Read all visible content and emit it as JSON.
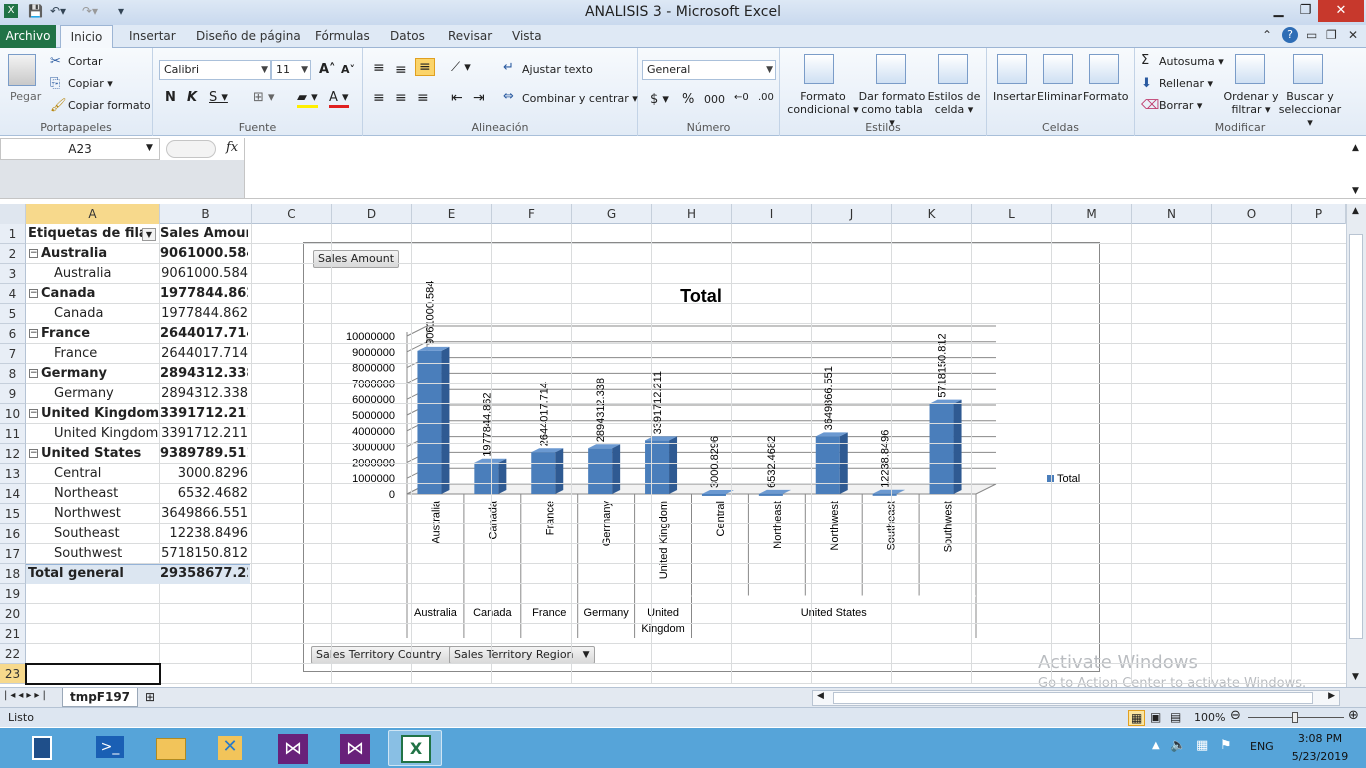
{
  "window": {
    "title": "ANALISIS 3  -  Microsoft Excel",
    "minimize": "▁",
    "restore": "❐",
    "close": "✕"
  },
  "tabs": [
    "Archivo",
    "Inicio",
    "Insertar",
    "Diseño de página",
    "Fórmulas",
    "Datos",
    "Revisar",
    "Vista"
  ],
  "ribbon": {
    "portapapeles": {
      "label": "Portapapeles",
      "pegar": "Pegar",
      "cortar": "Cortar",
      "copiar": "Copiar ▾",
      "copiar_formato": "Copiar formato"
    },
    "fuente": {
      "label": "Fuente",
      "font": "Calibri",
      "size": "11"
    },
    "alineacion": {
      "label": "Alineación",
      "ajustar": "Ajustar texto",
      "combinar": "Combinar y centrar ▾"
    },
    "numero": {
      "label": "Número",
      "format": "General"
    },
    "estilos": {
      "label": "Estilos",
      "formato_condicional": "Formato condicional ▾",
      "formato_tabla": "Dar formato como tabla ▾",
      "estilos_celda": "Estilos de celda ▾"
    },
    "celdas": {
      "label": "Celdas",
      "insertar": "Insertar",
      "eliminar": "Eliminar",
      "formato": "Formato"
    },
    "modificar": {
      "label": "Modificar",
      "autosuma": "Autosuma ▾",
      "rellenar": "Rellenar ▾",
      "borrar": "Borrar ▾",
      "ordenar": "Ordenar y filtrar ▾",
      "buscar": "Buscar y seleccionar ▾"
    }
  },
  "namebox": "A23",
  "fx": "fx",
  "columns": [
    "A",
    "B",
    "C",
    "D",
    "E",
    "F",
    "G",
    "H",
    "I",
    "J",
    "K",
    "L",
    "M",
    "N",
    "O",
    "P"
  ],
  "rows": [
    "1",
    "2",
    "3",
    "4",
    "5",
    "6",
    "7",
    "8",
    "9",
    "10",
    "11",
    "12",
    "13",
    "14",
    "15",
    "16",
    "17",
    "18",
    "19",
    "20",
    "21",
    "22",
    "23"
  ],
  "pivot": {
    "header_a": "Etiquetas de fila",
    "header_b": "Sales Amount",
    "rows": [
      {
        "label": "Australia",
        "value": "9061000.584",
        "level": 0
      },
      {
        "label": "Australia",
        "value": "9061000.584",
        "level": 1
      },
      {
        "label": "Canada",
        "value": "1977844.862",
        "level": 0
      },
      {
        "label": "Canada",
        "value": "1977844.862",
        "level": 1
      },
      {
        "label": "France",
        "value": "2644017.714",
        "level": 0
      },
      {
        "label": "France",
        "value": "2644017.714",
        "level": 1
      },
      {
        "label": "Germany",
        "value": "2894312.338",
        "level": 0
      },
      {
        "label": "Germany",
        "value": "2894312.338",
        "level": 1
      },
      {
        "label": "United Kingdom",
        "value": "3391712.211",
        "level": 0
      },
      {
        "label": "United Kingdom",
        "value": "3391712.211",
        "level": 1
      },
      {
        "label": "United States",
        "value": "9389789.511",
        "level": 0
      },
      {
        "label": "Central",
        "value": "3000.8296",
        "level": 1
      },
      {
        "label": "Northeast",
        "value": "6532.4682",
        "level": 1
      },
      {
        "label": "Northwest",
        "value": "3649866.551",
        "level": 1
      },
      {
        "label": "Southeast",
        "value": "12238.8496",
        "level": 1
      },
      {
        "label": "Southwest",
        "value": "5718150.812",
        "level": 1
      }
    ],
    "total_label": "Total general",
    "total_value": "29358677.22"
  },
  "chart_data": {
    "type": "bar",
    "title": "Total",
    "categories": [
      "Australia",
      "Canada",
      "France",
      "Germany",
      "United Kingdom",
      "Central",
      "Northeast",
      "Northwest",
      "Southeast",
      "Southwest"
    ],
    "groups": [
      "Australia",
      "Canada",
      "France",
      "Germany",
      "United Kingdom",
      "United States"
    ],
    "group_spans": [
      1,
      1,
      1,
      1,
      1,
      5
    ],
    "series": [
      {
        "name": "Total",
        "values": [
          9061000.584,
          1977844.862,
          2644017.714,
          2894312.338,
          3391712.211,
          3000.8296,
          6532.4682,
          3649866.551,
          12238.8496,
          5718150.812
        ]
      }
    ],
    "value_labels": [
      "9061000.584",
      "1977844.862",
      "2644017.714",
      "2894312.338",
      "3391712.211",
      "3000.8296",
      "6532.4682",
      "3649866.551",
      "12238.8496",
      "5718150.812"
    ],
    "yticks": [
      "0",
      "1000000",
      "2000000",
      "3000000",
      "4000000",
      "5000000",
      "6000000",
      "7000000",
      "8000000",
      "9000000",
      "10000000"
    ],
    "ylim": [
      0,
      10000000
    ],
    "legend": "right",
    "color": "#4a7ebb",
    "value_field": "Sales Amount",
    "axis_fields": [
      "Sales Territory Country",
      "Sales Territory Region"
    ]
  },
  "sheet_tab": "tmpF197",
  "status": {
    "ready": "Listo",
    "zoom": "100%"
  },
  "watermark": {
    "line1": "Activate Windows",
    "line2": "Go to Action Center to activate Windows."
  },
  "taskbar": {
    "lang": "ENG",
    "time": "3:08 PM",
    "date": "5/23/2019"
  }
}
